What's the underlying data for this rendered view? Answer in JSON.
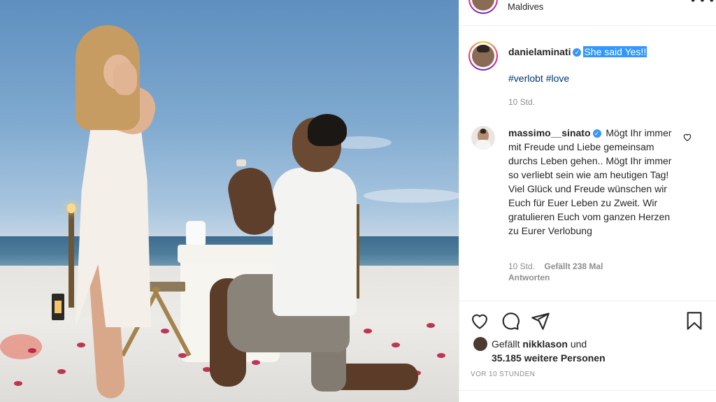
{
  "header": {
    "location": "Maldives"
  },
  "post": {
    "author": "danielaminati",
    "caption_highlighted": "She said Yes!!",
    "hashtags": "#verlobt #love",
    "time": "10 Std."
  },
  "comment": {
    "author": "massimo__sinato",
    "text": "Mögt Ihr immer mit Freude und Liebe gemeinsam durchs Leben gehen.. Mögt Ihr immer so verliebt sein wie am heutigen Tag! Viel Glück und Freude wünschen wir Euch für Euer Leben zu Zweit. Wir gratulieren Euch vom ganzen Herzen zu Eurer Verlobung",
    "time": "10 Std.",
    "likes": "Gefällt 238 Mal",
    "reply": "Antworten"
  },
  "likes": {
    "prefix": "Gefällt",
    "user": "nikklason",
    "conj": "und",
    "count_text": "35.185 weitere Personen"
  },
  "timestamp": "VOR 10 STUNDEN",
  "icons": {
    "like": "heart-icon",
    "comment": "comment-icon",
    "share": "paper-plane-icon",
    "save": "bookmark-icon",
    "more": "more-dots-icon",
    "verified": "verified-badge-icon"
  },
  "colors": {
    "link": "#00376b",
    "verified": "#3897f0",
    "selection": "#3297fd",
    "muted": "#8e8e8e"
  }
}
